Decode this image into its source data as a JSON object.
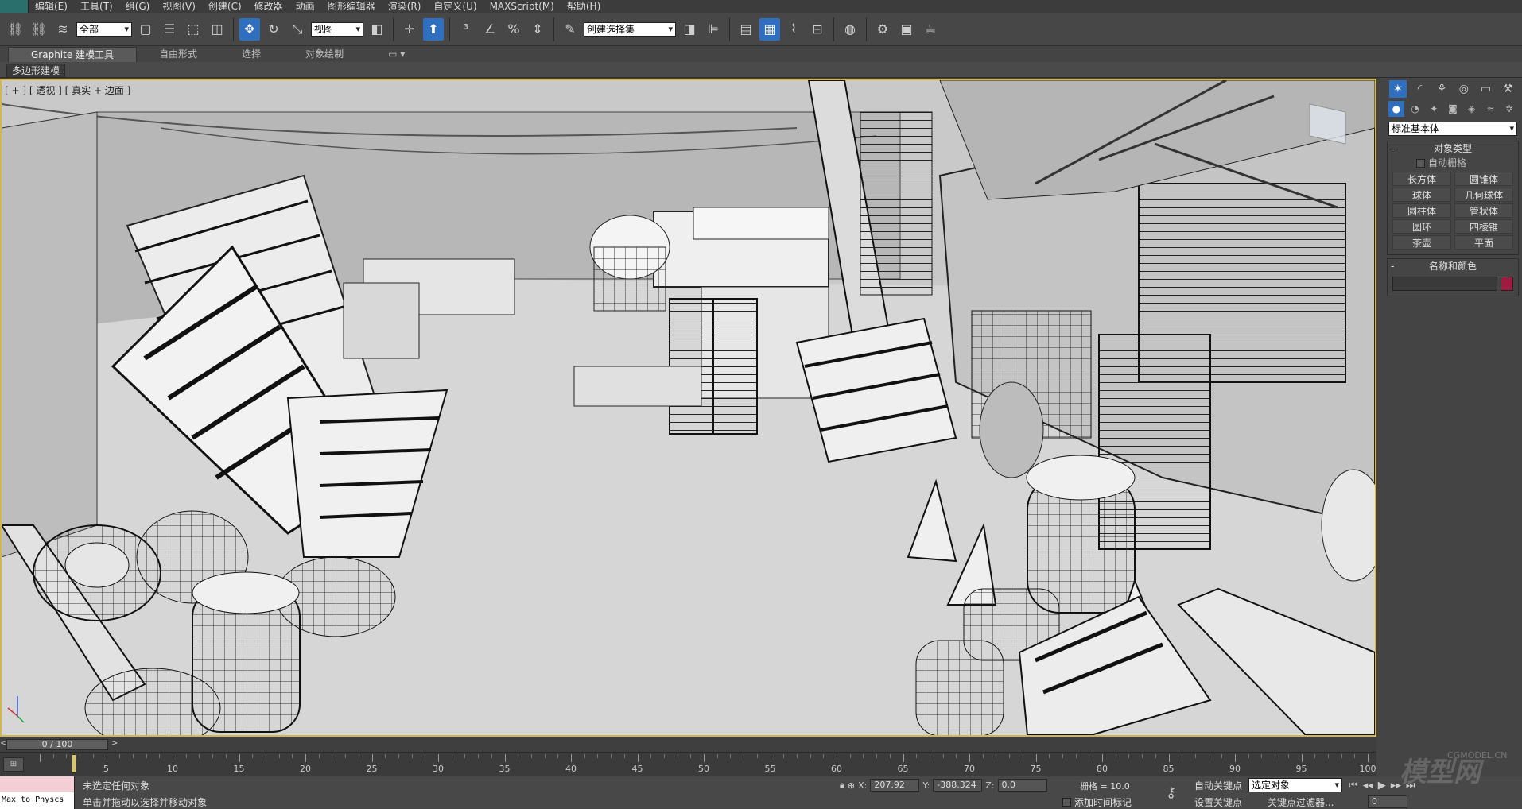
{
  "menubar": {
    "items": [
      "编辑(E)",
      "工具(T)",
      "组(G)",
      "视图(V)",
      "创建(C)",
      "修改器",
      "动画",
      "图形编辑器",
      "渲染(R)",
      "自定义(U)",
      "MAXScript(M)",
      "帮助(H)"
    ]
  },
  "toolbar": {
    "selection_filter": "全部",
    "ref_coord": "视图",
    "named_selection": "创建选择集"
  },
  "ribbon": {
    "tabs": [
      "Graphite 建模工具",
      "自由形式",
      "选择",
      "对象绘制"
    ],
    "sub_label": "多边形建模"
  },
  "viewport": {
    "label": "[ + ] [ 透视 ] [ 真实 + 边面 ]"
  },
  "command_panel": {
    "category": "标准基本体",
    "object_type_title": "对象类型",
    "auto_grid": "自动栅格",
    "objects": [
      "长方体",
      "圆锥体",
      "球体",
      "几何球体",
      "圆柱体",
      "管状体",
      "圆环",
      "四棱锥",
      "茶壶",
      "平面"
    ],
    "name_color_title": "名称和颜色",
    "color": "#9e1c40"
  },
  "timeline": {
    "slider_text": "0 / 100",
    "ticks": [
      5,
      10,
      15,
      20,
      25,
      30,
      35,
      40,
      45,
      50,
      55,
      60,
      65,
      70,
      75,
      80,
      85,
      90,
      95,
      100
    ]
  },
  "status": {
    "listener_text": "Max to Physcs",
    "line1": "未选定任何对象",
    "line2": "单击并拖动以选择并移动对象",
    "x_label": "X:",
    "x": "207.92",
    "y_label": "Y:",
    "y": "-388.324",
    "z_label": "Z:",
    "z": "0.0",
    "grid": "栅格 = 10.0",
    "auto_key": "自动关键点",
    "set_key": "设置关键点",
    "key_filter_combo": "选定对象",
    "key_filter": "关键点过滤器...",
    "add_time_tag": "添加时间标记",
    "frame": "0"
  },
  "watermark": {
    "site": "CGMODEL.CN",
    "brand": "模型网"
  }
}
